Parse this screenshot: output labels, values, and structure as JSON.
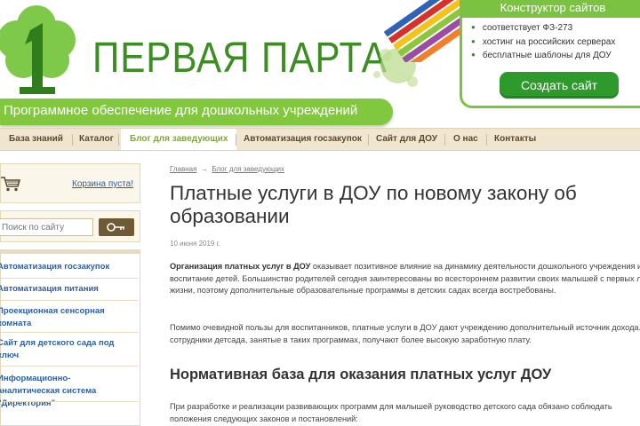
{
  "header": {
    "logo_text": "ПЕРВАЯ ПАРТА",
    "tagline": "Программное обеспечение для дошкольных учреждений",
    "promo": {
      "title": "Конструктор сайтов",
      "items": [
        "соответствует ФЗ-273",
        "хостинг на российских серверах",
        "бесплатные шаблоны для ДОУ"
      ],
      "button": "Создать сайт"
    }
  },
  "nav": {
    "items": [
      "База знаний",
      "Каталог",
      "Блог для заведующих",
      "Автоматизация госзакупок",
      "Сайт для ДОУ",
      "О нас",
      "Контакты"
    ],
    "active": "Блог для заведующих"
  },
  "sidebar": {
    "cart_label": "Корзина пуста!",
    "search_placeholder": "Поиск по сайту",
    "menu": [
      "Автоматизация госзакупок",
      "Автоматизация питания",
      "Проекционная сенсорная комната",
      "Сайт для детского сада под ключ",
      "Информационно-аналитическая система \"Директория\""
    ]
  },
  "article": {
    "breadcrumb": [
      "Главная",
      "→",
      "Блог для заведующих"
    ],
    "title": "Платные услуги в ДОУ по новому закону об образовании",
    "date": "10 июня 2019 г.",
    "p1_bold": "Организация платных услуг в ДОУ",
    "p1_rest": " оказывает позитивное влияние на динамику деятельности дошкольного учреждения и воспитание детей. Большинство родителей сегодня заинтересованы во всестороннем развитии своих малышей с первых лет жизни, поэтому дополнительные образовательные программы в детских садах всегда востребованы.",
    "p2": "Помимо очевидной пользы для воспитанников, платные услуги в ДОУ дают учреждению дополнительный источник дохода. А сотрудники детсада, занятые в таких программах, получают более высокую заработную плату.",
    "subheading": "Нормативная база для оказания платных услуг ДОУ",
    "p3": "При разработке и реализации развивающих программ для малышей руководство детского сада обязано соблюдать положения следующих законов и постановлений:"
  },
  "colors": {
    "brand_green": "#3c8d22",
    "light_green": "#82c83e",
    "button_green": "#2e9a2c",
    "nav_bg": "#f0e6cf",
    "link_blue": "#2d5fa0"
  }
}
